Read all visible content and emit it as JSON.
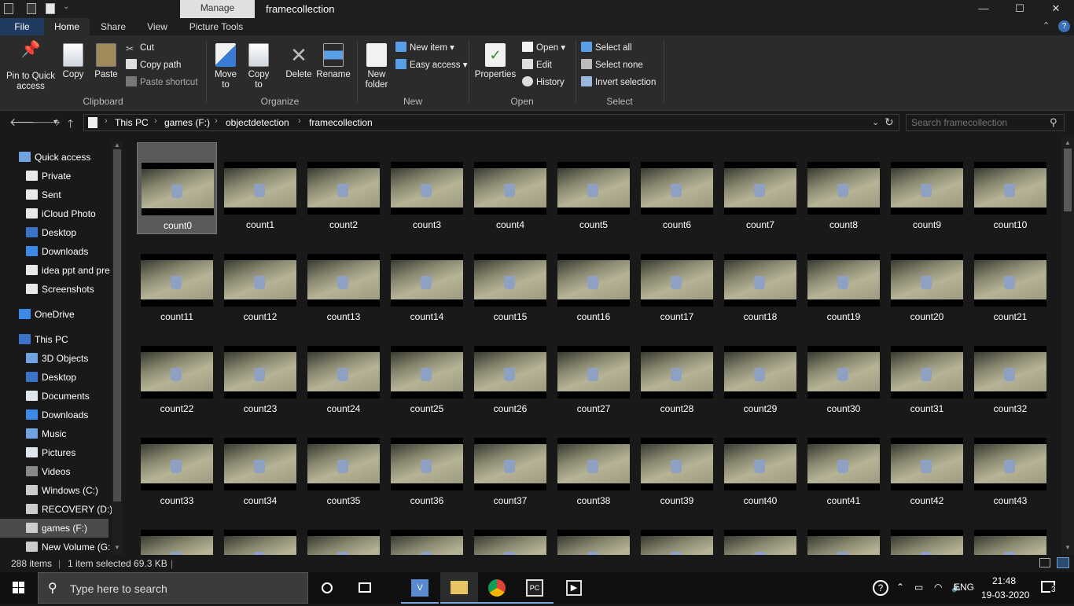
{
  "window": {
    "title": "framecollection",
    "context_tab": "Manage",
    "controls": {
      "minimize": "—",
      "maximize": "☐",
      "close": "✕"
    }
  },
  "tabs": [
    "File",
    "Home",
    "Share",
    "View",
    "Picture Tools"
  ],
  "ribbon": {
    "clipboard": {
      "label": "Clipboard",
      "pin": "Pin to Quick access",
      "copy": "Copy",
      "paste": "Paste",
      "cut": "Cut",
      "copy_path": "Copy path",
      "paste_shortcut": "Paste shortcut"
    },
    "organize": {
      "label": "Organize",
      "move_to": "Move to",
      "copy_to": "Copy to",
      "delete": "Delete",
      "rename": "Rename"
    },
    "new": {
      "label": "New",
      "new_folder": "New folder",
      "new_item": "New item",
      "easy_access": "Easy access"
    },
    "open": {
      "label": "Open",
      "properties": "Properties",
      "open": "Open",
      "edit": "Edit",
      "history": "History"
    },
    "select": {
      "label": "Select",
      "select_all": "Select all",
      "select_none": "Select none",
      "invert": "Invert selection"
    }
  },
  "breadcrumb": [
    "This PC",
    "games (F:)",
    "objectdetection",
    "framecollection"
  ],
  "search": {
    "placeholder": "Search framecollection"
  },
  "navpane": [
    {
      "label": "Quick access",
      "icon": "star-icon",
      "indent": 0
    },
    {
      "label": "Private",
      "icon": "document-icon",
      "indent": 1,
      "pinned": true
    },
    {
      "label": "Sent",
      "icon": "document-icon",
      "indent": 1,
      "pinned": true
    },
    {
      "label": "iCloud Photo",
      "icon": "icloud-icon",
      "indent": 1,
      "pinned": true
    },
    {
      "label": "Desktop",
      "icon": "desktop-icon",
      "indent": 1
    },
    {
      "label": "Downloads",
      "icon": "download-icon",
      "indent": 1
    },
    {
      "label": "idea ppt and pre",
      "icon": "document-icon",
      "indent": 1
    },
    {
      "label": "Screenshots",
      "icon": "document-icon",
      "indent": 1
    },
    {
      "label": "OneDrive",
      "icon": "cloud-icon",
      "indent": 0
    },
    {
      "label": "This PC",
      "icon": "computer-icon",
      "indent": 0
    },
    {
      "label": "3D Objects",
      "icon": "cube-icon",
      "indent": 1
    },
    {
      "label": "Desktop",
      "icon": "desktop-icon",
      "indent": 1
    },
    {
      "label": "Documents",
      "icon": "documents-icon",
      "indent": 1
    },
    {
      "label": "Downloads",
      "icon": "download-icon",
      "indent": 1
    },
    {
      "label": "Music",
      "icon": "music-icon",
      "indent": 1
    },
    {
      "label": "Pictures",
      "icon": "pictures-icon",
      "indent": 1
    },
    {
      "label": "Videos",
      "icon": "videos-icon",
      "indent": 1
    },
    {
      "label": "Windows (C:)",
      "icon": "drive-icon",
      "indent": 1
    },
    {
      "label": "RECOVERY (D:)",
      "icon": "drive-icon",
      "indent": 1
    },
    {
      "label": "games (F:)",
      "icon": "drive-icon",
      "indent": 1,
      "selected": true
    },
    {
      "label": "New Volume (G:",
      "icon": "drive-icon",
      "indent": 1
    }
  ],
  "files": [
    "count0",
    "count1",
    "count2",
    "count3",
    "count4",
    "count5",
    "count6",
    "count7",
    "count8",
    "count9",
    "count10",
    "count11",
    "count12",
    "count13",
    "count14",
    "count15",
    "count16",
    "count17",
    "count18",
    "count19",
    "count20",
    "count21",
    "count22",
    "count23",
    "count24",
    "count25",
    "count26",
    "count27",
    "count28",
    "count29",
    "count30",
    "count31",
    "count32",
    "count33",
    "count34",
    "count35",
    "count36",
    "count37",
    "count38",
    "count39",
    "count40",
    "count41",
    "count42",
    "count43",
    "",
    "",
    "",
    "",
    "",
    "",
    "",
    "",
    "",
    "",
    ""
  ],
  "selected_file": "count0",
  "status": {
    "items": "288 items",
    "selected": "1 item selected  69.3 KB"
  },
  "taskbar": {
    "search_placeholder": "Type here to search",
    "language": "ENG",
    "time": "21:48",
    "date": "19-03-2020",
    "notifications": "3"
  },
  "colors": {
    "accent": "#1f3b5f",
    "background": "#191919",
    "ribbon": "#2b2b2b",
    "selection": "#5a5a5a"
  }
}
